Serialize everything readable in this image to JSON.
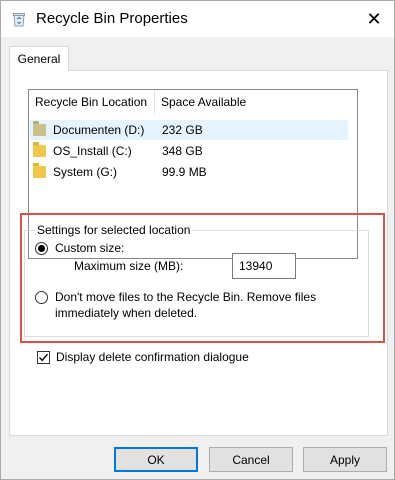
{
  "window": {
    "title": "Recycle Bin Properties",
    "close_glyph": "✕"
  },
  "tabs": [
    {
      "label": "General",
      "active": true
    }
  ],
  "locations": {
    "columns": [
      "Recycle Bin Location",
      "Space Available"
    ],
    "rows": [
      {
        "location": "Documenten (D:)",
        "space": "232 GB",
        "selected": true
      },
      {
        "location": "OS_Install (C:)",
        "space": "348 GB",
        "selected": false
      },
      {
        "location": "System (G:)",
        "space": "99.9 MB",
        "selected": false
      }
    ]
  },
  "settings": {
    "group_title": "Settings for selected location",
    "custom_size_label": "Custom size:",
    "custom_size_selected": true,
    "max_size_label": "Maximum size (MB):",
    "max_size_value": "13940",
    "dont_move_label_line1": "Don't move files to the Recycle Bin. Remove files",
    "dont_move_label_line2": "immediately when deleted.",
    "dont_move_selected": false
  },
  "display_confirm": {
    "label": "Display delete confirmation dialogue",
    "checked": true
  },
  "buttons": {
    "ok": "OK",
    "cancel": "Cancel",
    "apply": "Apply"
  },
  "colors": {
    "highlight_border": "#e0504a",
    "selected_row": "#e5f3ff",
    "default_button_border": "#0078d7"
  }
}
